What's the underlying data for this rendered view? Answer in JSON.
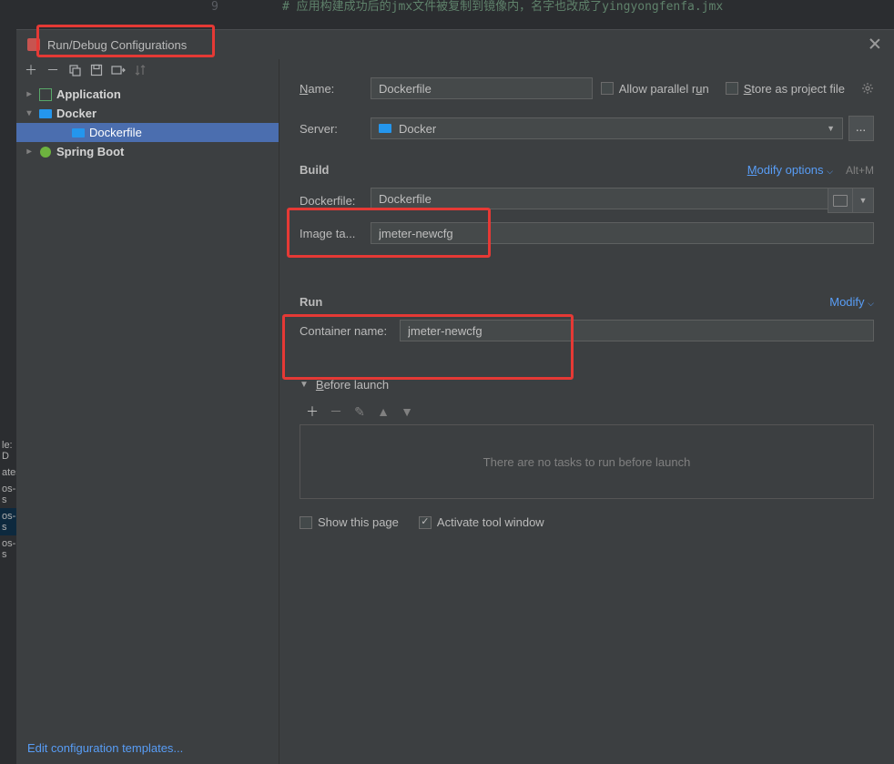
{
  "editor": {
    "line_no": "9",
    "comment": "# 应用构建成功后的jmx文件被复制到镜像内，名字也改成了yingyongfenfa.jmx"
  },
  "bg_panel": {
    "items": [
      "le: D",
      "ates",
      "os-s",
      "os-s",
      "os-s"
    ],
    "selected_index": 3
  },
  "dialog_title": "Run/Debug Configurations",
  "toolbar_icons": [
    "add",
    "remove",
    "copy",
    "save",
    "folder",
    "sort"
  ],
  "tree": {
    "items": [
      {
        "label": "Application",
        "icon": "application",
        "expanded": true,
        "depth": 0,
        "bold": true,
        "selected": false
      },
      {
        "label": "Docker",
        "icon": "docker",
        "expanded": true,
        "depth": 0,
        "bold": true,
        "selected": false
      },
      {
        "label": "Dockerfile",
        "icon": "docker",
        "depth": 1,
        "bold": false,
        "selected": true
      },
      {
        "label": "Spring Boot",
        "icon": "spring",
        "expanded": true,
        "depth": 0,
        "bold": true,
        "selected": false
      }
    ]
  },
  "left_footer_link": "Edit configuration templates...",
  "form": {
    "name_label": "Name:",
    "name_value": "Dockerfile",
    "allow_parallel": {
      "label": "Allow parallel run",
      "checked": false
    },
    "store_project": {
      "label": "Store as project file",
      "checked": false
    },
    "server_label": "Server:",
    "server_value": "Docker",
    "ellipsis": "...",
    "build": {
      "title": "Build",
      "modify_link": "Modify options",
      "shortcut": "Alt+M",
      "dockerfile_label": "Dockerfile:",
      "dockerfile_value": "Dockerfile",
      "image_tag_label": "Image ta...",
      "image_tag_value": "jmeter-newcfg"
    },
    "run": {
      "title": "Run",
      "modify_link": "Modify",
      "container_name_label": "Container name:",
      "container_name_value": "jmeter-newcfg"
    },
    "before_launch": {
      "title": "Before launch",
      "placeholder": "There are no tasks to run before launch"
    },
    "show_this_page": {
      "label": "Show this page",
      "checked": false
    },
    "activate_tool_window": {
      "label": "Activate tool window",
      "checked": true
    }
  }
}
